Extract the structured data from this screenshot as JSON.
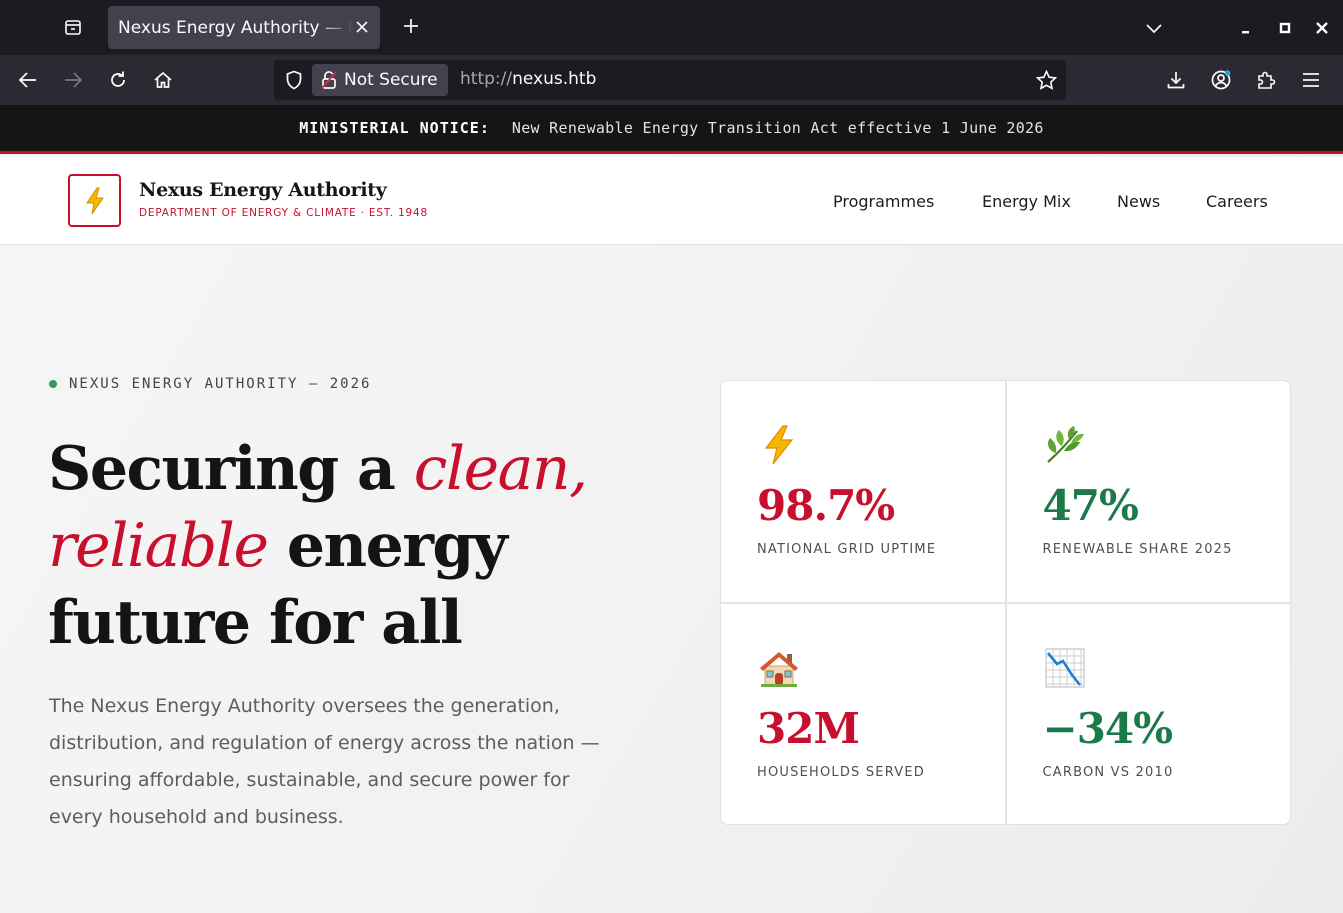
{
  "browser": {
    "tab_title": "Nexus Energy Authority — Portal",
    "security_label": "Not Secure",
    "url_scheme": "http://",
    "url_host": "nexus.htb"
  },
  "notice": {
    "label": "MINISTERIAL NOTICE:",
    "text": "New Renewable Energy Transition Act effective 1 June 2026"
  },
  "header": {
    "brand_name": "Nexus Energy Authority",
    "brand_subtitle": "DEPARTMENT OF ENERGY & CLIMATE · EST. 1948",
    "nav": [
      "Programmes",
      "Energy Mix",
      "News",
      "Careers"
    ]
  },
  "hero": {
    "eyebrow": "NEXUS ENERGY AUTHORITY — 2026",
    "title_part1": "Securing a ",
    "title_accent1": "clean,",
    "title_accent2": "reliable",
    "title_part2": " energy future for all",
    "description": "The Nexus Energy Authority oversees the generation, distribution, and regulation of energy across the nation — ensuring affordable, sustainable, and secure power for every household and business."
  },
  "stats": [
    {
      "icon": "lightning-icon",
      "value": "98.7%",
      "label": "NATIONAL GRID UPTIME"
    },
    {
      "icon": "leaf-icon",
      "value": "47%",
      "label": "RENEWABLE SHARE 2025"
    },
    {
      "icon": "house-icon",
      "value": "32M",
      "label": "HOUSEHOLDS SERVED"
    },
    {
      "icon": "chart-decreasing-icon",
      "value": "−34%",
      "label": "CARBON VS 2010"
    }
  ],
  "colors": {
    "accent_red": "#c8102e",
    "accent_green": "#1c7a4a",
    "status_dot": "#2e9a5c"
  }
}
